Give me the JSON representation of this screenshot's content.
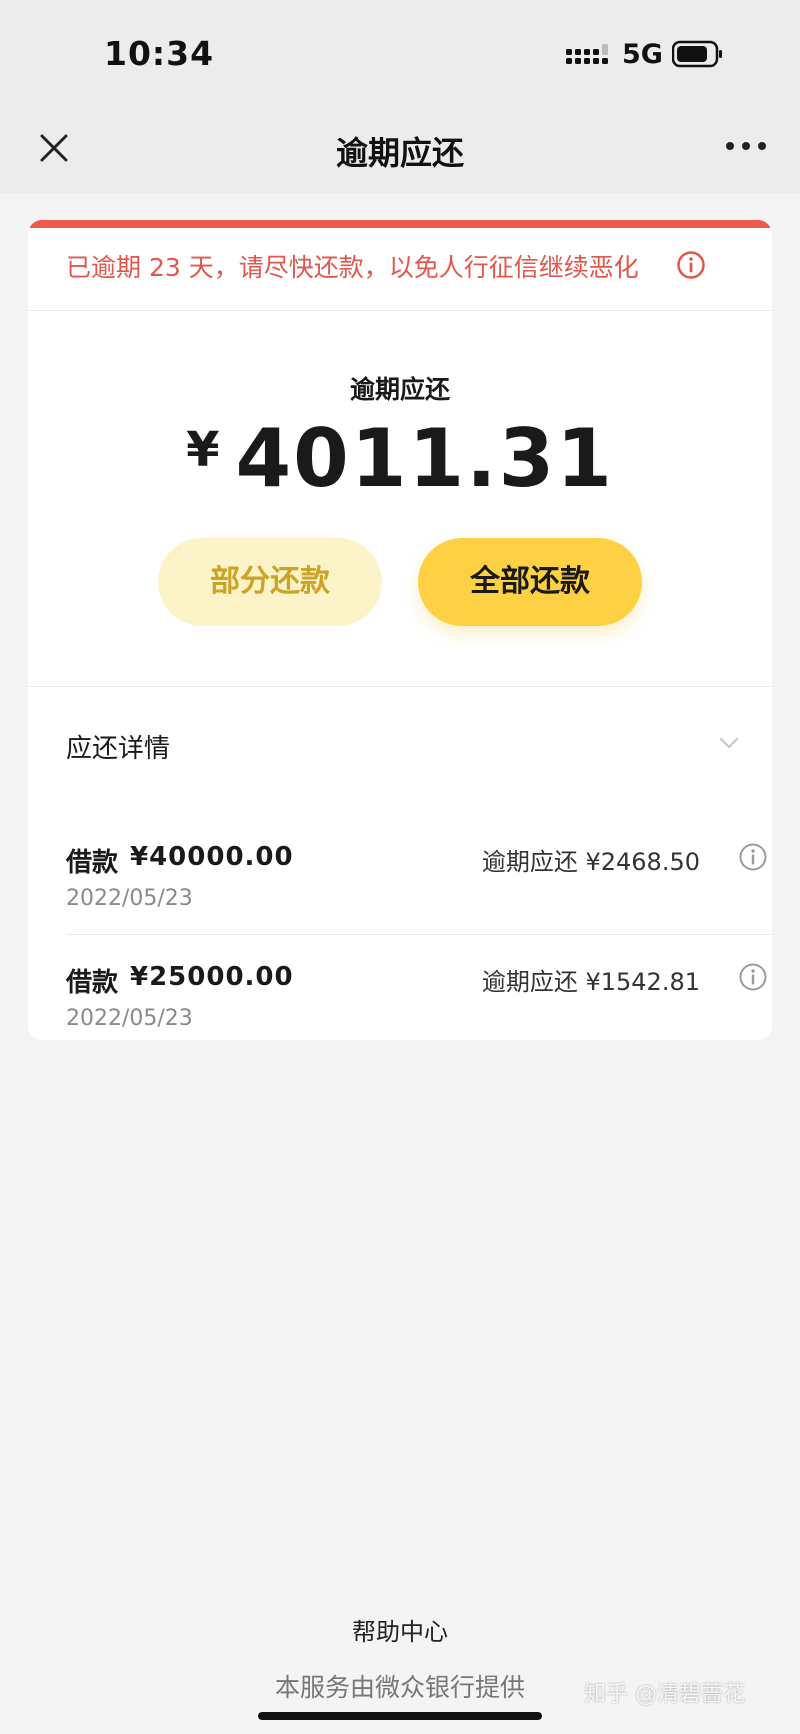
{
  "status_bar": {
    "time": "10:34",
    "network": "5G"
  },
  "nav": {
    "title": "逾期应还",
    "close_icon": "close-icon",
    "more_icon": "more-dots-icon"
  },
  "alert": {
    "text": "已逾期 23 天，请尽快还款，以免人行征信继续恶化",
    "icon": "info-icon",
    "color": "#e2574c"
  },
  "summary": {
    "label": "逾期应还",
    "currency": "¥",
    "amount": "4011.31"
  },
  "actions": {
    "partial_label": "部分还款",
    "full_label": "全部还款"
  },
  "details": {
    "header": "应还详情",
    "toggle_icon": "chevron-down-icon",
    "loans": [
      {
        "prefix": "借款",
        "amount": "¥40000.00",
        "date": "2022/05/23",
        "overdue": "逾期应还 ¥2468.50"
      },
      {
        "prefix": "借款",
        "amount": "¥25000.00",
        "date": "2022/05/23",
        "overdue": "逾期应还 ¥1542.81"
      }
    ]
  },
  "footer": {
    "help": "帮助中心",
    "provider": "本服务由微众银行提供",
    "watermark": "知乎 @清碧蔷花"
  },
  "colors": {
    "accent": "#fed145",
    "accent_light": "#fdf3c8",
    "alert": "#ef5a4f"
  }
}
